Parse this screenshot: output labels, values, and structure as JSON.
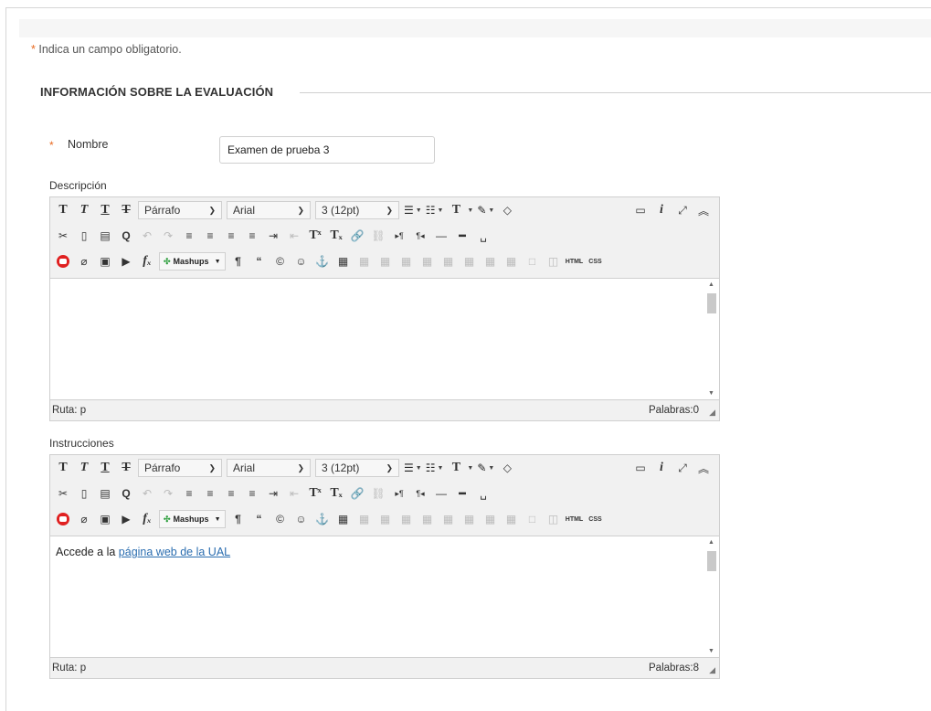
{
  "required_note": {
    "star": "*",
    "text": "Indica un campo obligatorio."
  },
  "section": {
    "title": "INFORMACIÓN SOBRE LA EVALUACIÓN"
  },
  "name_field": {
    "star": "*",
    "label": "Nombre",
    "value": "Examen de prueba 3"
  },
  "description": {
    "label": "Descripción",
    "toolbar": {
      "format": "Párrafo",
      "font": "Arial",
      "size": "3 (12pt)",
      "mashups": "Mashups",
      "html": "HTML",
      "css": "CSS"
    },
    "content": "",
    "path_label": "Ruta:",
    "path_value": "p",
    "word_count": "Palabras:0"
  },
  "instructions": {
    "label": "Instrucciones",
    "toolbar": {
      "format": "Párrafo",
      "font": "Arial",
      "size": "3 (12pt)",
      "mashups": "Mashups",
      "html": "HTML",
      "css": "CSS"
    },
    "content_prefix": "Accede a la ",
    "content_link": "página web de la UAL",
    "path_label": "Ruta:",
    "path_value": "p",
    "word_count": "Palabras:8"
  },
  "colors": {
    "required": "#e8691f",
    "link": "#2a6db0",
    "youtube": "#e02020"
  }
}
